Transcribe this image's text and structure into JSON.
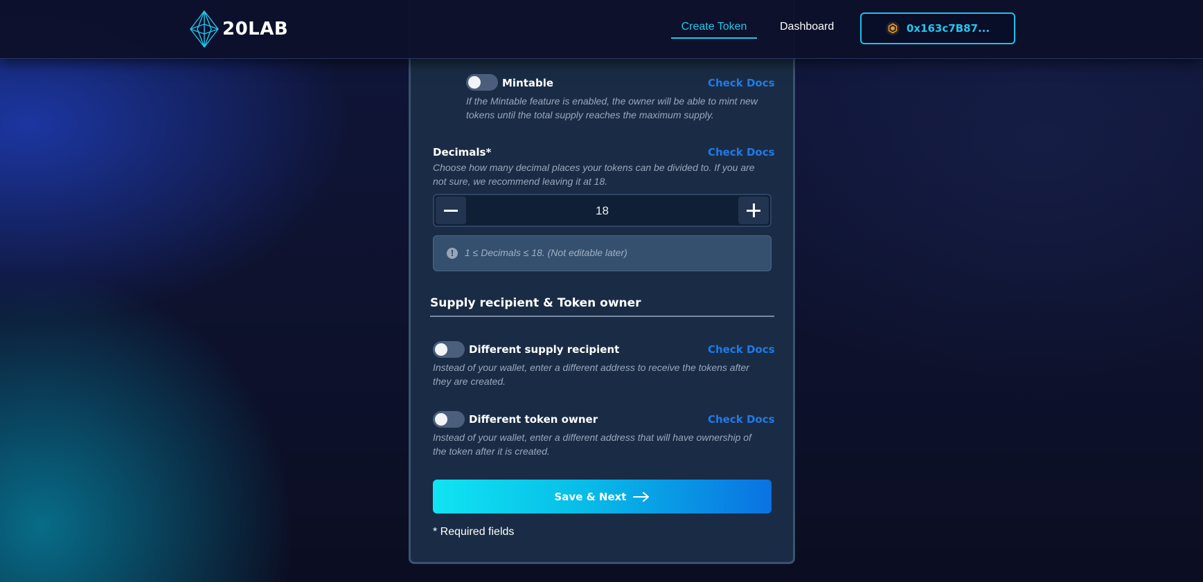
{
  "header": {
    "brand": "20LAB",
    "nav": {
      "create_token": "Create Token",
      "dashboard": "Dashboard"
    },
    "wallet": {
      "address": "0x163c7B87...",
      "icon": "hexagon-wallet-icon"
    }
  },
  "form": {
    "mintable": {
      "label": "Mintable",
      "docs": "Check Docs",
      "description": "If the Mintable feature is enabled, the owner will be able to mint new tokens until the total supply reaches the maximum supply.",
      "enabled": false
    },
    "decimals": {
      "label": "Decimals*",
      "docs": "Check Docs",
      "description": "Choose how many decimal places your tokens can be divided to. If you are not sure, we recommend leaving it at 18.",
      "value": "18",
      "hint": "1 ≤ Decimals ≤ 18. (Not editable later)"
    },
    "section_title": "Supply recipient & Token owner",
    "supply_recipient": {
      "label": "Different supply recipient",
      "docs": "Check Docs",
      "description": "Instead of your wallet, enter a different address to receive the tokens after they are created.",
      "enabled": false
    },
    "token_owner": {
      "label": "Different token owner",
      "docs": "Check Docs",
      "description": "Instead of your wallet, enter a different address that will have ownership of the token after it is created.",
      "enabled": false
    },
    "save_button": "Save & Next",
    "required_note": "* Required fields"
  },
  "colors": {
    "accent": "#22c7ee",
    "link": "#1f7ae8",
    "card": "#1a2c45"
  }
}
